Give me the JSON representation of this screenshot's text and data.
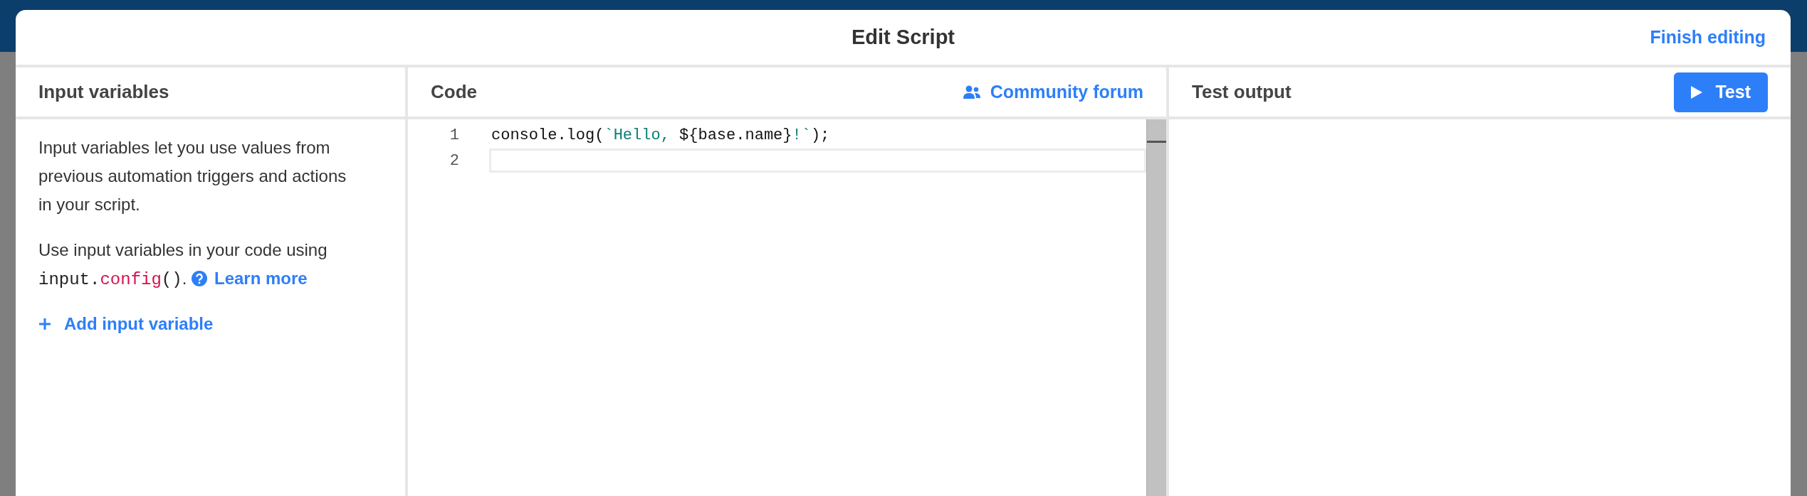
{
  "dialog": {
    "title": "Edit Script",
    "finish_link": "Finish editing"
  },
  "input_panel": {
    "title": "Input variables",
    "description": "Input variables let you use values from previous automation triggers and actions in your script.",
    "usage": [
      {
        "kind": "text",
        "text": "Use input variables in your code using "
      },
      {
        "kind": "code",
        "text": "input."
      },
      {
        "kind": "code_keyword",
        "text": "config"
      },
      {
        "kind": "code",
        "text": "()"
      },
      {
        "kind": "text",
        "text": ". "
      }
    ],
    "learn_more": "Learn more",
    "add_button": "Add input variable"
  },
  "code_panel": {
    "title": "Code",
    "forum_link": "Community forum",
    "lines": [
      {
        "number": "1",
        "current": false,
        "tokens": [
          {
            "kind": "plain",
            "text": "console.log("
          },
          {
            "kind": "string",
            "text": "`Hello, "
          },
          {
            "kind": "plain",
            "text": "${base.name}"
          },
          {
            "kind": "string",
            "text": "!`"
          },
          {
            "kind": "plain",
            "text": ");"
          }
        ]
      },
      {
        "number": "2",
        "current": true
      }
    ]
  },
  "output_panel": {
    "title": "Test output",
    "test_button": "Test"
  }
}
